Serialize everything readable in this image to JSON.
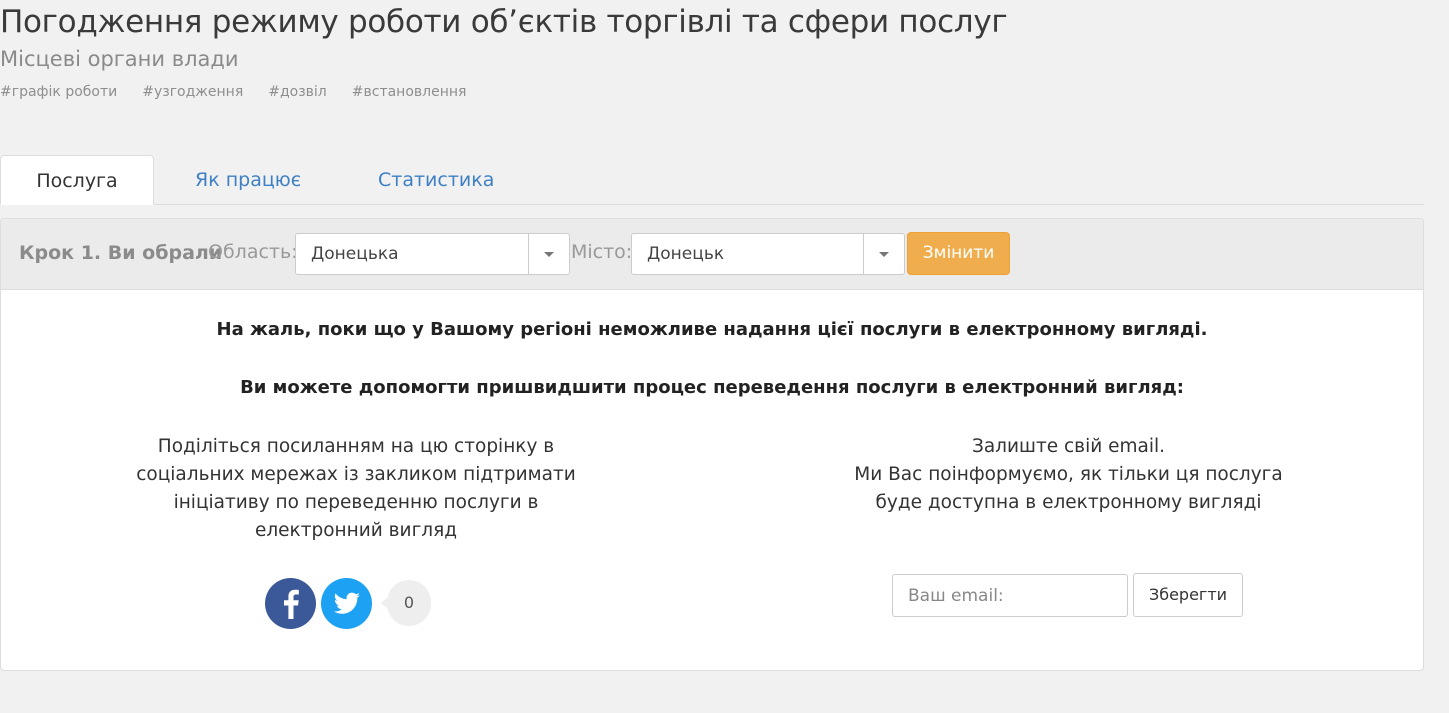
{
  "header": {
    "title": "Погодження режиму роботи об’єктів торгівлі та сфери послуг",
    "subtitle": "Місцеві органи влади",
    "tags": [
      "#графік роботи",
      "#узгодження",
      "#дозвіл",
      "#встановлення"
    ]
  },
  "tabs": [
    {
      "label": "Послуга",
      "active": true
    },
    {
      "label": "Як працює",
      "active": false
    },
    {
      "label": "Статистика",
      "active": false
    }
  ],
  "step": {
    "title": "Крок 1. Ви обрали",
    "region_label": "Область:",
    "region_value": "Донецька",
    "city_label": "Місто:",
    "city_value": "Донецьк",
    "change_button": "Змінити"
  },
  "messages": {
    "unavailable": "На жаль, поки що у Вашому регіоні неможливе надання цієї послуги в електронному вигляді.",
    "help": "Ви можете допомогти пришвидшити процес переведення послуги в електронний вигляд:"
  },
  "share": {
    "text_lines": [
      "Поділіться посиланням на цю сторінку в",
      "соціальних мережах із закликом підтримати",
      "ініціативу по переведенню послуги в",
      "електронний вигляд"
    ],
    "count": "0",
    "icons": [
      "facebook-icon",
      "twitter-icon"
    ]
  },
  "notify": {
    "text_lines": [
      "Залиште свій email.",
      "Ми Вас поінформуємо, як тільки ця послуга",
      "буде доступна в електронному вигляді"
    ],
    "email_placeholder": "Ваш email:",
    "save_button": "Зберегти"
  },
  "colors": {
    "accent": "#f0ad4e",
    "link": "#3f80c4",
    "facebook": "#3b5998",
    "twitter": "#1da1f2"
  }
}
